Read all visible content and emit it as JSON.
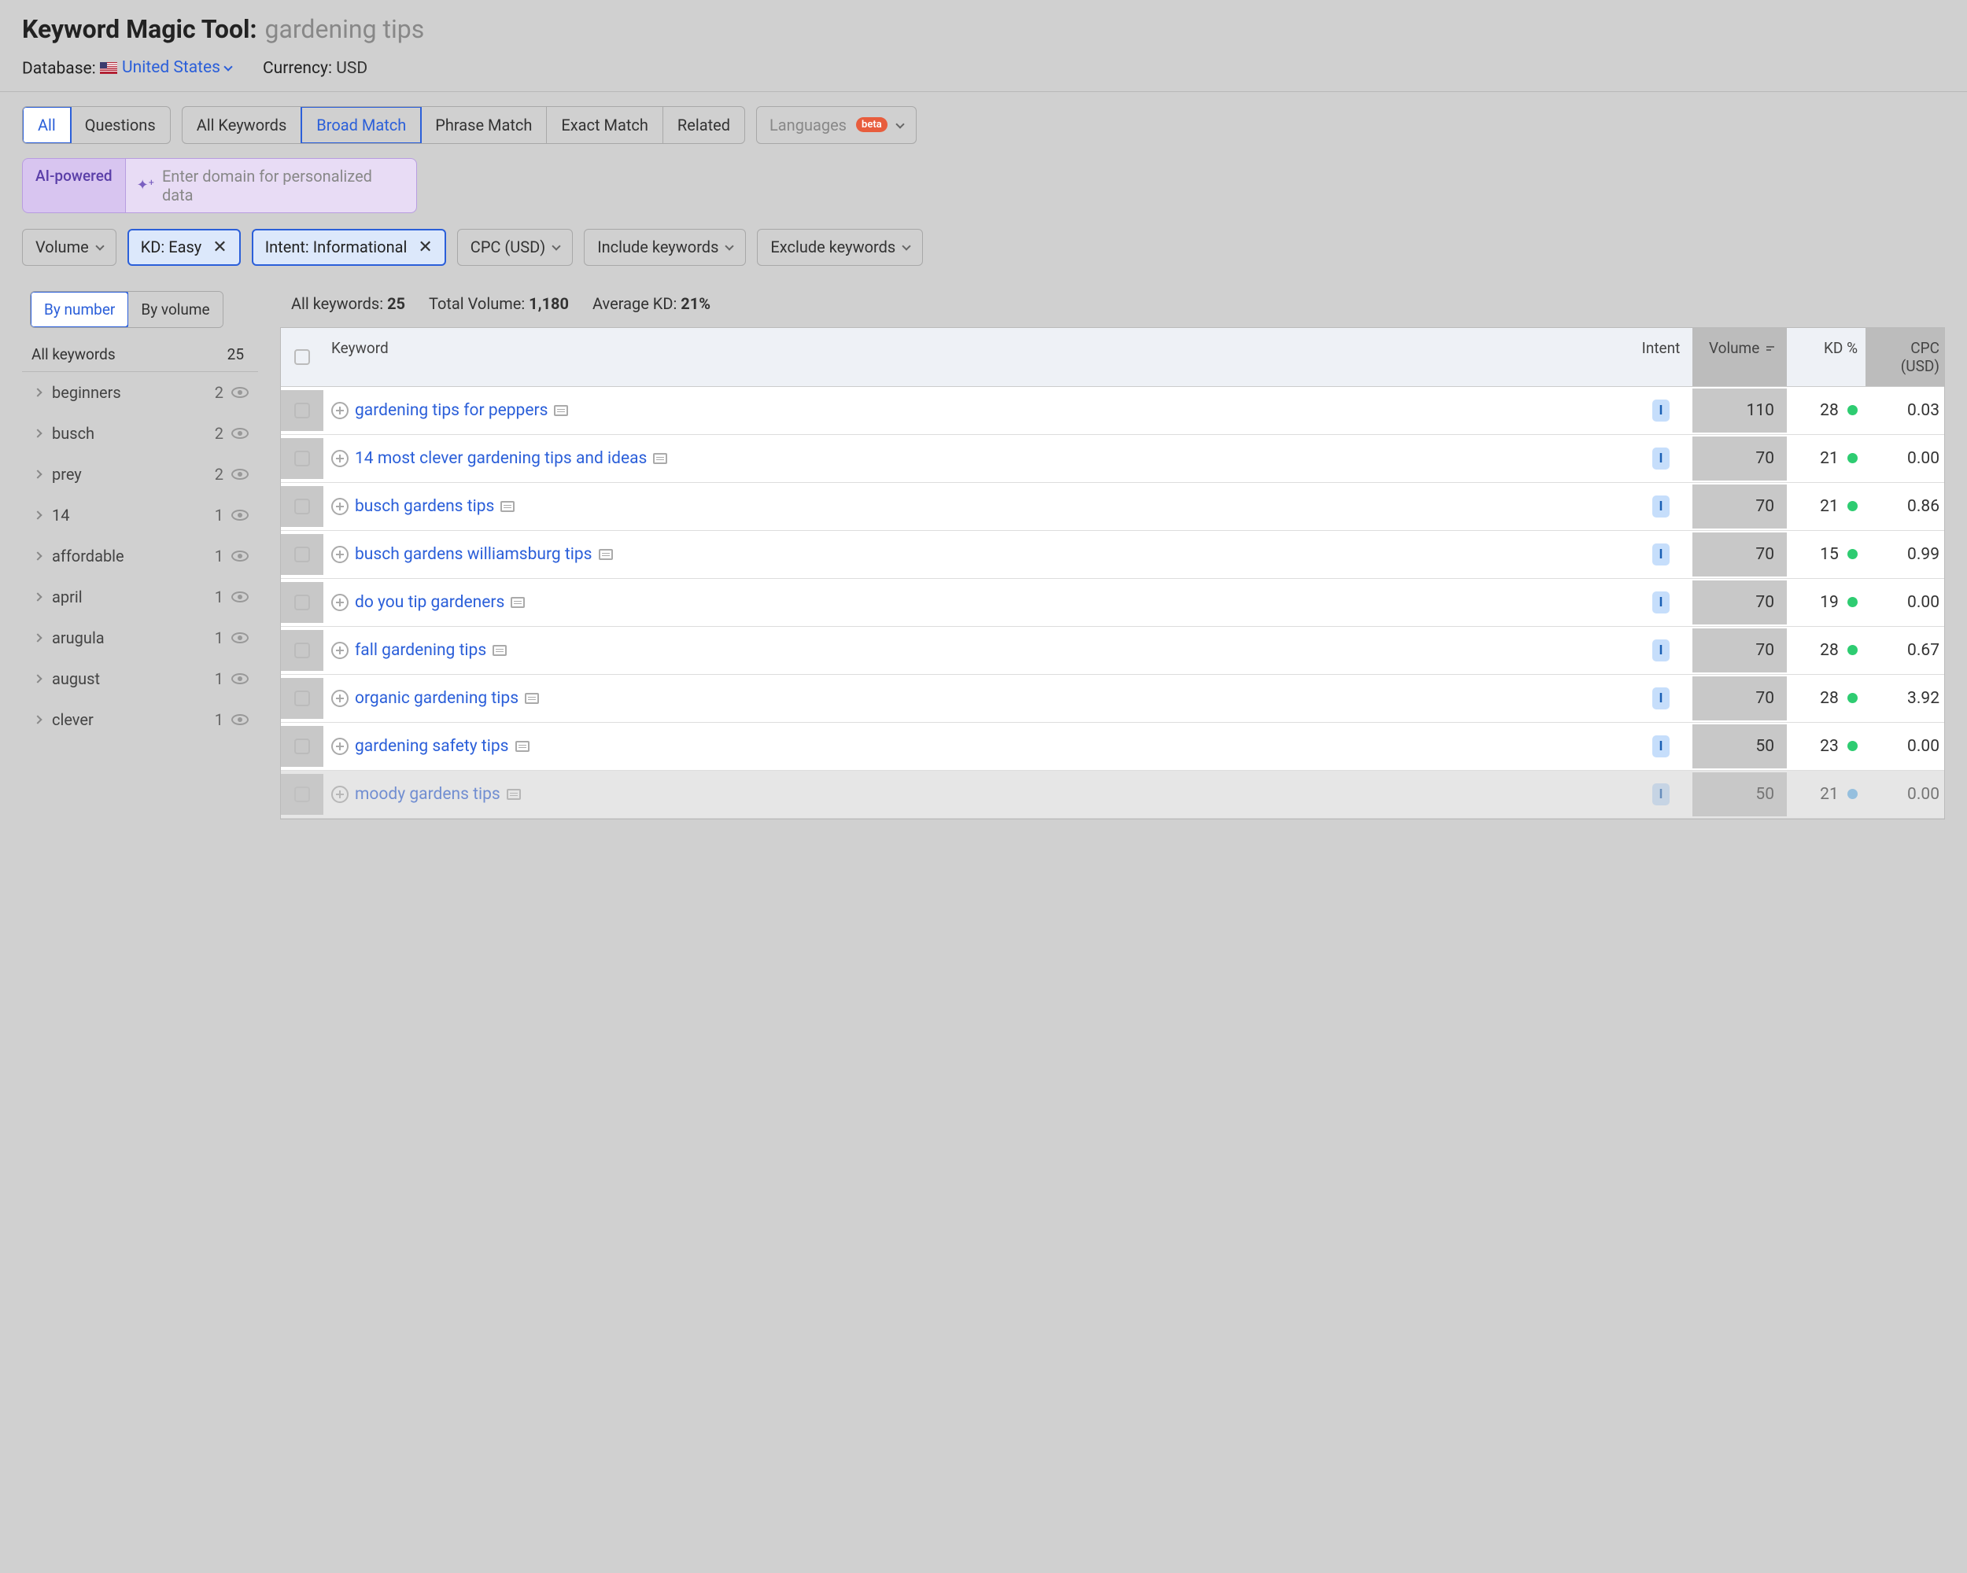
{
  "header": {
    "tool": "Keyword Magic Tool:",
    "query": "gardening tips",
    "db_label": "Database:",
    "db_val": "United States",
    "cur_label": "Currency:",
    "cur_val": "USD"
  },
  "tabs1": {
    "all": "All",
    "questions": "Questions"
  },
  "tabs2": {
    "all": "All Keywords",
    "broad": "Broad Match",
    "phrase": "Phrase Match",
    "exact": "Exact Match",
    "related": "Related"
  },
  "lang": {
    "label": "Languages",
    "beta": "beta"
  },
  "ai": {
    "badge": "AI-powered",
    "placeholder": "Enter domain for personalized data"
  },
  "filters": {
    "volume": "Volume",
    "kd": "KD: Easy",
    "intent": "Intent: Informational",
    "cpc": "CPC (USD)",
    "include": "Include keywords",
    "exclude": "Exclude keywords"
  },
  "side": {
    "by_number": "By number",
    "by_volume": "By volume",
    "all_kw": "All keywords",
    "all_ct": "25",
    "items": [
      {
        "name": "beginners",
        "count": "2"
      },
      {
        "name": "busch",
        "count": "2"
      },
      {
        "name": "prey",
        "count": "2"
      },
      {
        "name": "14",
        "count": "1"
      },
      {
        "name": "affordable",
        "count": "1"
      },
      {
        "name": "april",
        "count": "1"
      },
      {
        "name": "arugula",
        "count": "1"
      },
      {
        "name": "august",
        "count": "1"
      },
      {
        "name": "clever",
        "count": "1"
      }
    ]
  },
  "stats": {
    "l1": "All keywords:",
    "v1": "25",
    "l2": "Total Volume:",
    "v2": "1,180",
    "l3": "Average KD:",
    "v3": "21%"
  },
  "cols": {
    "kw": "Keyword",
    "intent": "Intent",
    "vol": "Volume",
    "kd": "KD %",
    "cpc": "CPC (USD)"
  },
  "rows": [
    {
      "kw": "gardening tips for peppers",
      "intent": "I",
      "vol": "110",
      "kd": "28",
      "cpc": "0.03",
      "dot": "g"
    },
    {
      "kw": "14 most clever gardening tips and ideas",
      "intent": "I",
      "vol": "70",
      "kd": "21",
      "cpc": "0.00",
      "dot": "g"
    },
    {
      "kw": "busch gardens tips",
      "intent": "I",
      "vol": "70",
      "kd": "21",
      "cpc": "0.86",
      "dot": "g"
    },
    {
      "kw": "busch gardens williamsburg tips",
      "intent": "I",
      "vol": "70",
      "kd": "15",
      "cpc": "0.99",
      "dot": "g"
    },
    {
      "kw": "do you tip gardeners",
      "intent": "I",
      "vol": "70",
      "kd": "19",
      "cpc": "0.00",
      "dot": "g"
    },
    {
      "kw": "fall gardening tips",
      "intent": "I",
      "vol": "70",
      "kd": "28",
      "cpc": "0.67",
      "dot": "g"
    },
    {
      "kw": "organic gardening tips",
      "intent": "I",
      "vol": "70",
      "kd": "28",
      "cpc": "3.92",
      "dot": "g"
    },
    {
      "kw": "gardening safety tips",
      "intent": "I",
      "vol": "50",
      "kd": "23",
      "cpc": "0.00",
      "dot": "g"
    },
    {
      "kw": "moody gardens tips",
      "intent": "I",
      "vol": "50",
      "kd": "21",
      "cpc": "0.00",
      "dot": "b"
    }
  ]
}
